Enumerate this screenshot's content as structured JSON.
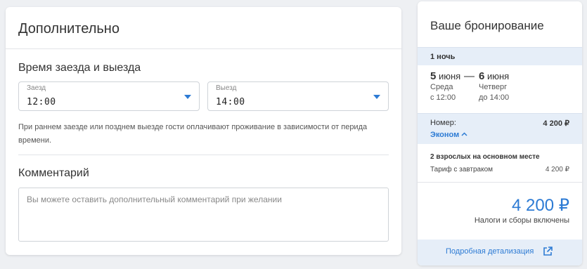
{
  "extra": {
    "title": "Дополнительно",
    "checkin_section_title": "Время заезда и выезда",
    "checkin": {
      "label": "Заезд",
      "value": "12:00"
    },
    "checkout": {
      "label": "Выезд",
      "value": "14:00"
    },
    "note": "При раннем заезде или позднем выезде гости оплачивают проживание в зависимости от перида времени.",
    "comment_title": "Комментарий",
    "comment_placeholder": "Вы можете оставить дополнительный комментарий при желании"
  },
  "booking": {
    "title": "Ваше бронирование",
    "nights": "1 ночь",
    "start": {
      "day": "5",
      "month": "июня",
      "weekday": "Среда",
      "time": "с 12:00"
    },
    "end": {
      "day": "6",
      "month": "июня",
      "weekday": "Четверг",
      "time": "до 14:00"
    },
    "dash": "—",
    "room_label": "Номер:",
    "room_price": "4 200 ₽",
    "room_type": "Эконом",
    "room_type_chevron": "^",
    "guests": "2 взрослых на основном месте",
    "tariff": "Тариф с завтраком",
    "tariff_price": "4 200 ₽",
    "total": "4 200 ₽",
    "taxes": "Налоги и сборы включены",
    "details_link": "Подробная детализация"
  },
  "colors": {
    "accent": "#2d7bd4",
    "panel": "#e6eef8",
    "background": "#eef0f3"
  }
}
